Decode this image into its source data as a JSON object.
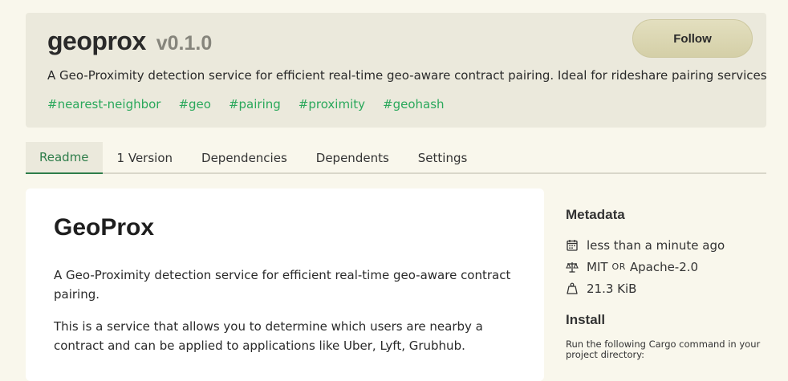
{
  "crate": {
    "name": "geoprox",
    "version": "v0.1.0",
    "follow_label": "Follow",
    "description": "A Geo-Proximity detection service for efficient real-time geo-aware contract pairing. Ideal for rideshare pairing services",
    "keywords": [
      "#nearest-neighbor",
      "#geo",
      "#pairing",
      "#proximity",
      "#geohash"
    ]
  },
  "tabs": [
    {
      "label": "Readme",
      "active": true
    },
    {
      "label": "1 Version",
      "active": false
    },
    {
      "label": "Dependencies",
      "active": false
    },
    {
      "label": "Dependents",
      "active": false
    },
    {
      "label": "Settings",
      "active": false
    }
  ],
  "readme": {
    "title": "GeoProx",
    "paragraph1": "A Geo-Proximity detection service for efficient real-time geo-aware contract pairing.",
    "paragraph2": "This is a service that allows you to determine which users are nearby a contract and can be applied to applications like Uber, Lyft, Grubhub."
  },
  "sidebar": {
    "metadata_title": "Metadata",
    "updated": "less than a minute ago",
    "license_a": "MIT",
    "license_or": "or",
    "license_b": "Apache-2.0",
    "size": "21.3 KiB",
    "install_title": "Install",
    "install_text": "Run the following Cargo command in your project directory:"
  },
  "icons": [
    "calendar-icon",
    "scale-icon",
    "weight-icon"
  ],
  "colors": {
    "accent_green": "#2e7d4a",
    "keyword_green": "#2aa85b",
    "background": "#f9f7ec",
    "header_bg": "#ebe9dc"
  }
}
